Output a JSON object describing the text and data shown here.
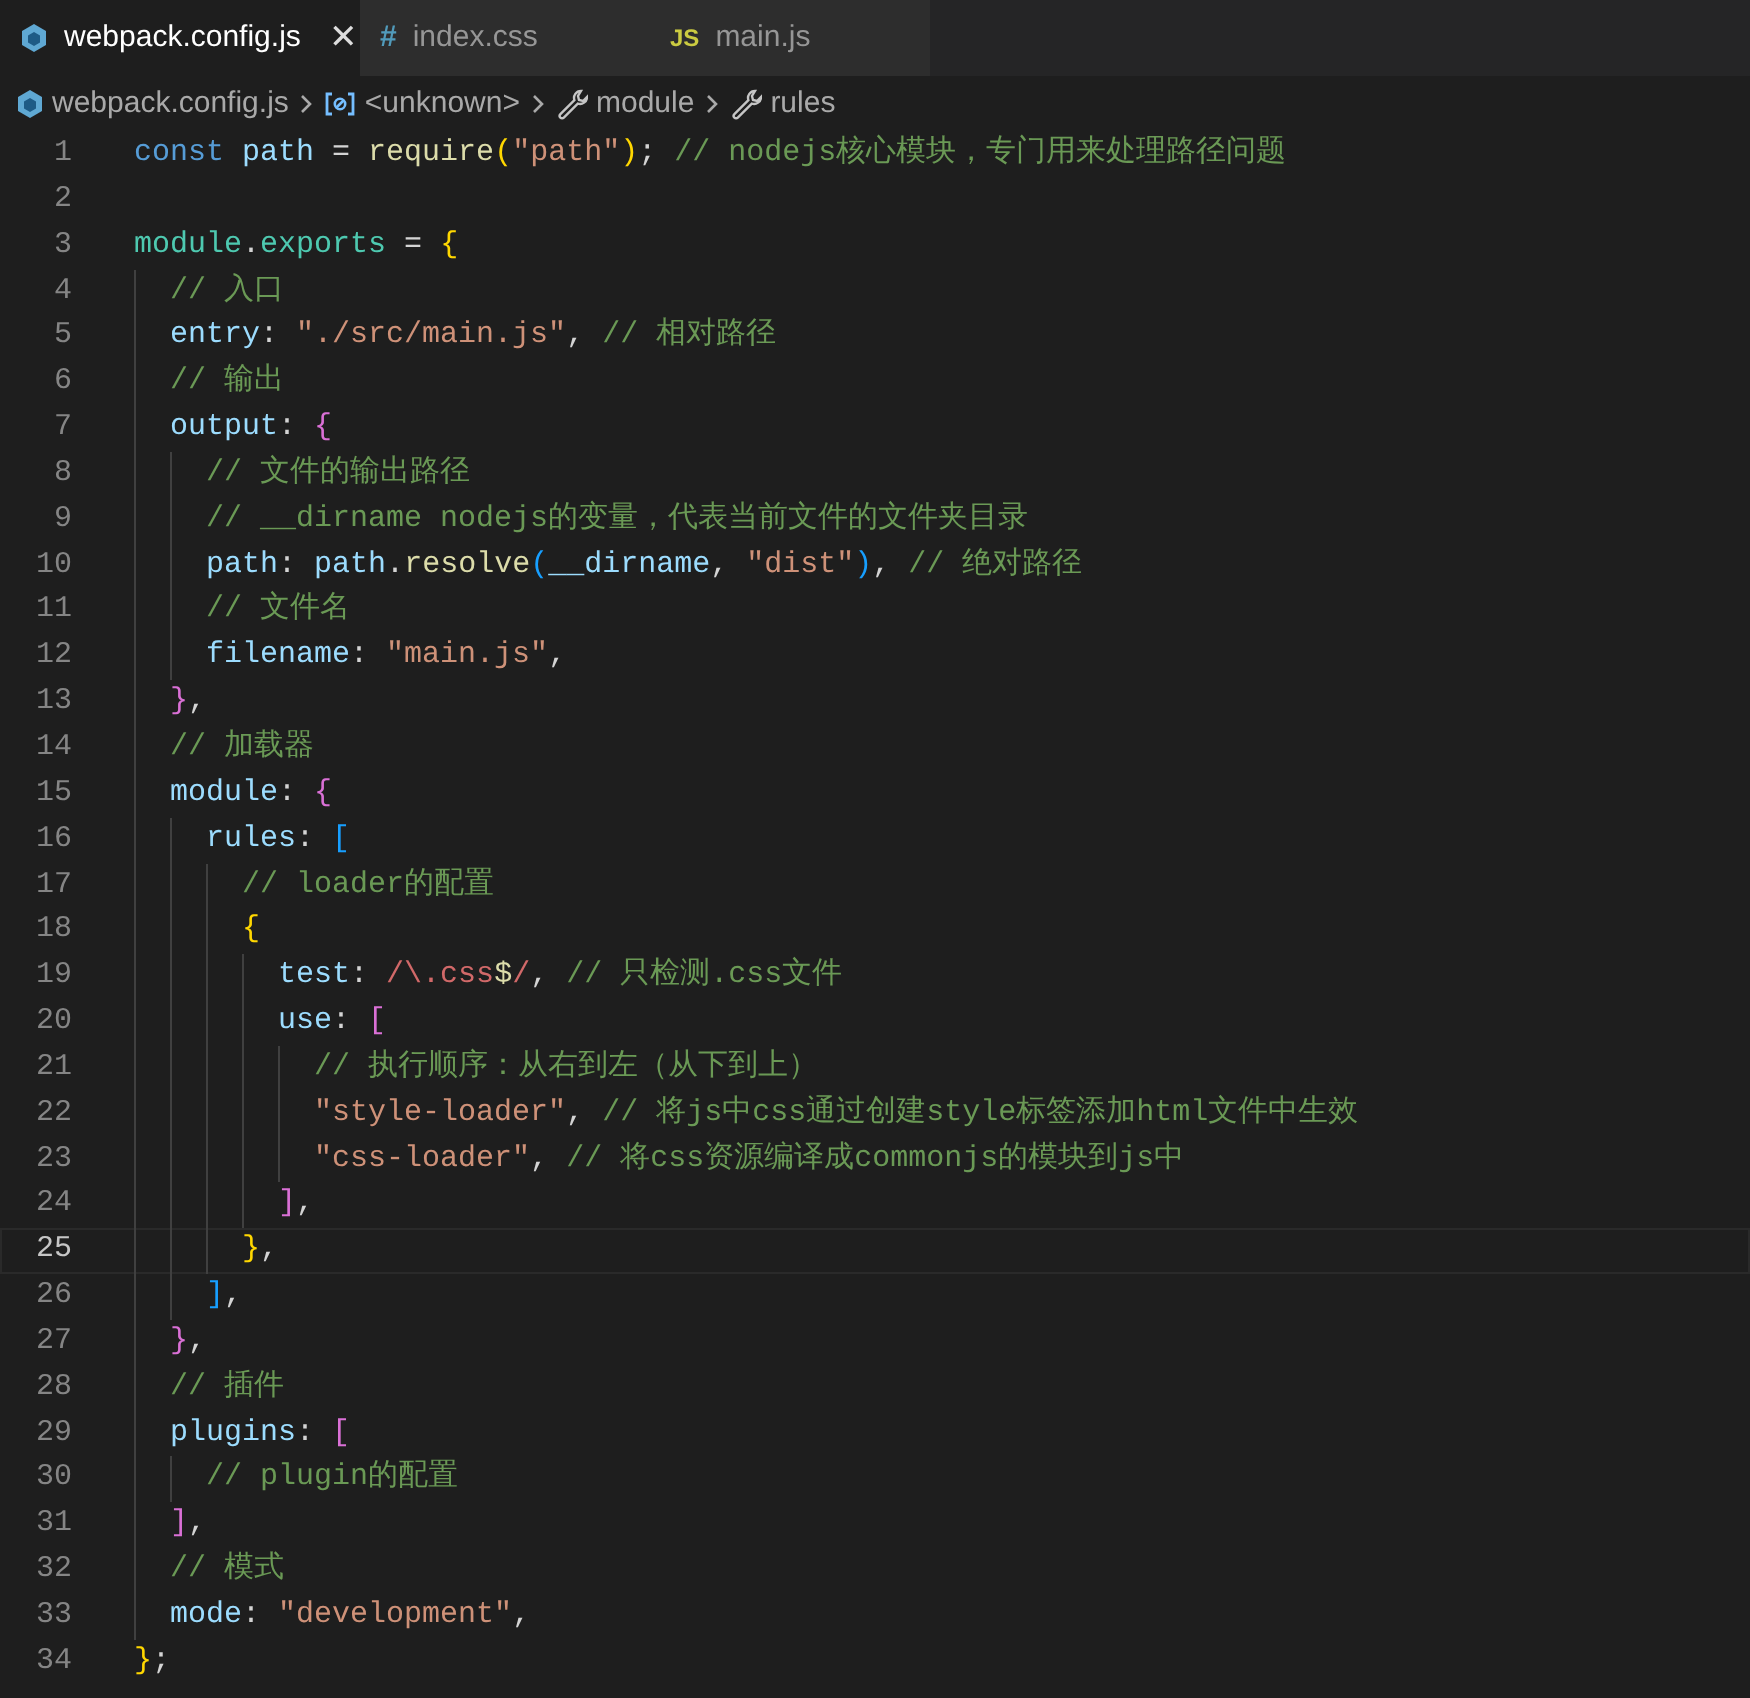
{
  "tabs": [
    {
      "label": "webpack.config.js",
      "kind": "webpack",
      "selected": true,
      "close_glyph": "✕"
    },
    {
      "label": "index.css",
      "kind": "css",
      "icon_text": "#",
      "selected": false
    },
    {
      "label": "main.js",
      "kind": "js",
      "icon_text": "JS",
      "selected": false
    }
  ],
  "breadcrumb": [
    {
      "label": "webpack.config.js",
      "kind": "file"
    },
    {
      "label": "<unknown>",
      "kind": "variable"
    },
    {
      "label": "module",
      "kind": "property"
    },
    {
      "label": "rules",
      "kind": "property"
    }
  ],
  "lines": [
    {
      "number": "1",
      "current": false,
      "tokens": [
        {
          "kind": "kw",
          "text": "const "
        },
        {
          "kind": "var",
          "text": "path"
        },
        {
          "kind": "p",
          "text": " = "
        },
        {
          "kind": "fn",
          "text": "require"
        },
        {
          "kind": "b1",
          "text": "("
        },
        {
          "kind": "str",
          "text": "\"path\""
        },
        {
          "kind": "b1",
          "text": ")"
        },
        {
          "kind": "p",
          "text": "; "
        },
        {
          "kind": "cmt",
          "text": "// nodejs核心模块，专门用来处理路径问题"
        }
      ]
    },
    {
      "number": "2",
      "current": false
    },
    {
      "number": "3",
      "current": false,
      "tokens": [
        {
          "kind": "type",
          "text": "module"
        },
        {
          "kind": "p",
          "text": "."
        },
        {
          "kind": "type",
          "text": "exports"
        },
        {
          "kind": "p",
          "text": " = "
        },
        {
          "kind": "b1",
          "text": "{"
        }
      ]
    },
    {
      "number": "4",
      "current": false,
      "tokens": [
        {
          "kind": "cmt",
          "text": "  // 入口"
        }
      ]
    },
    {
      "number": "5",
      "current": false,
      "tokens": [
        {
          "kind": "var",
          "text": "  entry"
        },
        {
          "kind": "p",
          "text": ": "
        },
        {
          "kind": "str",
          "text": "\"./src/main.js\""
        },
        {
          "kind": "p",
          "text": ", "
        },
        {
          "kind": "cmt",
          "text": "// 相对路径"
        }
      ]
    },
    {
      "number": "6",
      "current": false,
      "tokens": [
        {
          "kind": "cmt",
          "text": "  // 输出"
        }
      ]
    },
    {
      "number": "7",
      "current": false,
      "tokens": [
        {
          "kind": "var",
          "text": "  output"
        },
        {
          "kind": "p",
          "text": ": "
        },
        {
          "kind": "b2",
          "text": "{"
        }
      ]
    },
    {
      "number": "8",
      "current": false,
      "tokens": [
        {
          "kind": "cmt",
          "text": "    // 文件的输出路径"
        }
      ]
    },
    {
      "number": "9",
      "current": false,
      "tokens": [
        {
          "kind": "cmt",
          "text": "    // __dirname nodejs的变量，代表当前文件的文件夹目录"
        }
      ]
    },
    {
      "number": "10",
      "current": false,
      "tokens": [
        {
          "kind": "var",
          "text": "    path"
        },
        {
          "kind": "p",
          "text": ": "
        },
        {
          "kind": "var",
          "text": "path"
        },
        {
          "kind": "p",
          "text": "."
        },
        {
          "kind": "fn",
          "text": "resolve"
        },
        {
          "kind": "b3",
          "text": "("
        },
        {
          "kind": "var",
          "text": "__dirname"
        },
        {
          "kind": "p",
          "text": ", "
        },
        {
          "kind": "str",
          "text": "\"dist\""
        },
        {
          "kind": "b3",
          "text": ")"
        },
        {
          "kind": "p",
          "text": ", "
        },
        {
          "kind": "cmt",
          "text": "// 绝对路径"
        }
      ]
    },
    {
      "number": "11",
      "current": false,
      "tokens": [
        {
          "kind": "cmt",
          "text": "    // 文件名"
        }
      ]
    },
    {
      "number": "12",
      "current": false,
      "tokens": [
        {
          "kind": "var",
          "text": "    filename"
        },
        {
          "kind": "p",
          "text": ": "
        },
        {
          "kind": "str",
          "text": "\"main.js\""
        },
        {
          "kind": "p",
          "text": ","
        }
      ]
    },
    {
      "number": "13",
      "current": false,
      "tokens": [
        {
          "kind": "b2",
          "text": "  }"
        },
        {
          "kind": "p",
          "text": ","
        }
      ]
    },
    {
      "number": "14",
      "current": false,
      "tokens": [
        {
          "kind": "cmt",
          "text": "  // 加载器"
        }
      ]
    },
    {
      "number": "15",
      "current": false,
      "tokens": [
        {
          "kind": "var",
          "text": "  module"
        },
        {
          "kind": "p",
          "text": ": "
        },
        {
          "kind": "b2",
          "text": "{"
        }
      ]
    },
    {
      "number": "16",
      "current": false,
      "tokens": [
        {
          "kind": "var",
          "text": "    rules"
        },
        {
          "kind": "p",
          "text": ": "
        },
        {
          "kind": "b3",
          "text": "["
        }
      ]
    },
    {
      "number": "17",
      "current": false,
      "tokens": [
        {
          "kind": "cmt",
          "text": "      // loader的配置"
        }
      ]
    },
    {
      "number": "18",
      "current": false,
      "tokens": [
        {
          "kind": "b1",
          "text": "      {"
        }
      ]
    },
    {
      "number": "19",
      "current": false,
      "tokens": [
        {
          "kind": "var",
          "text": "        test"
        },
        {
          "kind": "p",
          "text": ": "
        },
        {
          "kind": "re",
          "text": "/\\.css"
        },
        {
          "kind": "fn",
          "text": "$"
        },
        {
          "kind": "re",
          "text": "/"
        },
        {
          "kind": "p",
          "text": ", "
        },
        {
          "kind": "cmt",
          "text": "// 只检测.css文件"
        }
      ]
    },
    {
      "number": "20",
      "current": false,
      "tokens": [
        {
          "kind": "var",
          "text": "        use"
        },
        {
          "kind": "p",
          "text": ": "
        },
        {
          "kind": "b2",
          "text": "["
        }
      ]
    },
    {
      "number": "21",
      "current": false,
      "tokens": [
        {
          "kind": "cmt",
          "text": "          // 执行顺序：从右到左（从下到上）"
        }
      ]
    },
    {
      "number": "22",
      "current": false,
      "tokens": [
        {
          "kind": "str",
          "text": "          \"style-loader\""
        },
        {
          "kind": "p",
          "text": ", "
        },
        {
          "kind": "cmt",
          "text": "// 将js中css通过创建style标签添加html文件中生效"
        }
      ]
    },
    {
      "number": "23",
      "current": false,
      "tokens": [
        {
          "kind": "str",
          "text": "          \"css-loader\""
        },
        {
          "kind": "p",
          "text": ", "
        },
        {
          "kind": "cmt",
          "text": "// 将css资源编译成commonjs的模块到js中"
        }
      ]
    },
    {
      "number": "24",
      "current": false,
      "tokens": [
        {
          "kind": "b2",
          "text": "        ]"
        },
        {
          "kind": "p",
          "text": ","
        }
      ]
    },
    {
      "number": "25",
      "current": true,
      "tokens": [
        {
          "kind": "b1",
          "text": "      }"
        },
        {
          "kind": "p",
          "text": ","
        }
      ]
    },
    {
      "number": "26",
      "current": false,
      "tokens": [
        {
          "kind": "b3",
          "text": "    ]"
        },
        {
          "kind": "p",
          "text": ","
        }
      ]
    },
    {
      "number": "27",
      "current": false,
      "tokens": [
        {
          "kind": "b2",
          "text": "  }"
        },
        {
          "kind": "p",
          "text": ","
        }
      ]
    },
    {
      "number": "28",
      "current": false,
      "tokens": [
        {
          "kind": "cmt",
          "text": "  // 插件"
        }
      ]
    },
    {
      "number": "29",
      "current": false,
      "tokens": [
        {
          "kind": "var",
          "text": "  plugins"
        },
        {
          "kind": "p",
          "text": ": "
        },
        {
          "kind": "b2",
          "text": "["
        }
      ]
    },
    {
      "number": "30",
      "current": false,
      "tokens": [
        {
          "kind": "cmt",
          "text": "    // plugin的配置"
        }
      ]
    },
    {
      "number": "31",
      "current": false,
      "tokens": [
        {
          "kind": "b2",
          "text": "  ]"
        },
        {
          "kind": "p",
          "text": ","
        }
      ]
    },
    {
      "number": "32",
      "current": false,
      "tokens": [
        {
          "kind": "cmt",
          "text": "  // 模式"
        }
      ]
    },
    {
      "number": "33",
      "current": false,
      "tokens": [
        {
          "kind": "var",
          "text": "  mode"
        },
        {
          "kind": "p",
          "text": ": "
        },
        {
          "kind": "str",
          "text": "\"development\""
        },
        {
          "kind": "p",
          "text": ","
        }
      ]
    },
    {
      "number": "34",
      "current": false,
      "tokens": [
        {
          "kind": "b1",
          "text": "}"
        },
        {
          "kind": "p",
          "text": ";"
        }
      ]
    }
  ]
}
